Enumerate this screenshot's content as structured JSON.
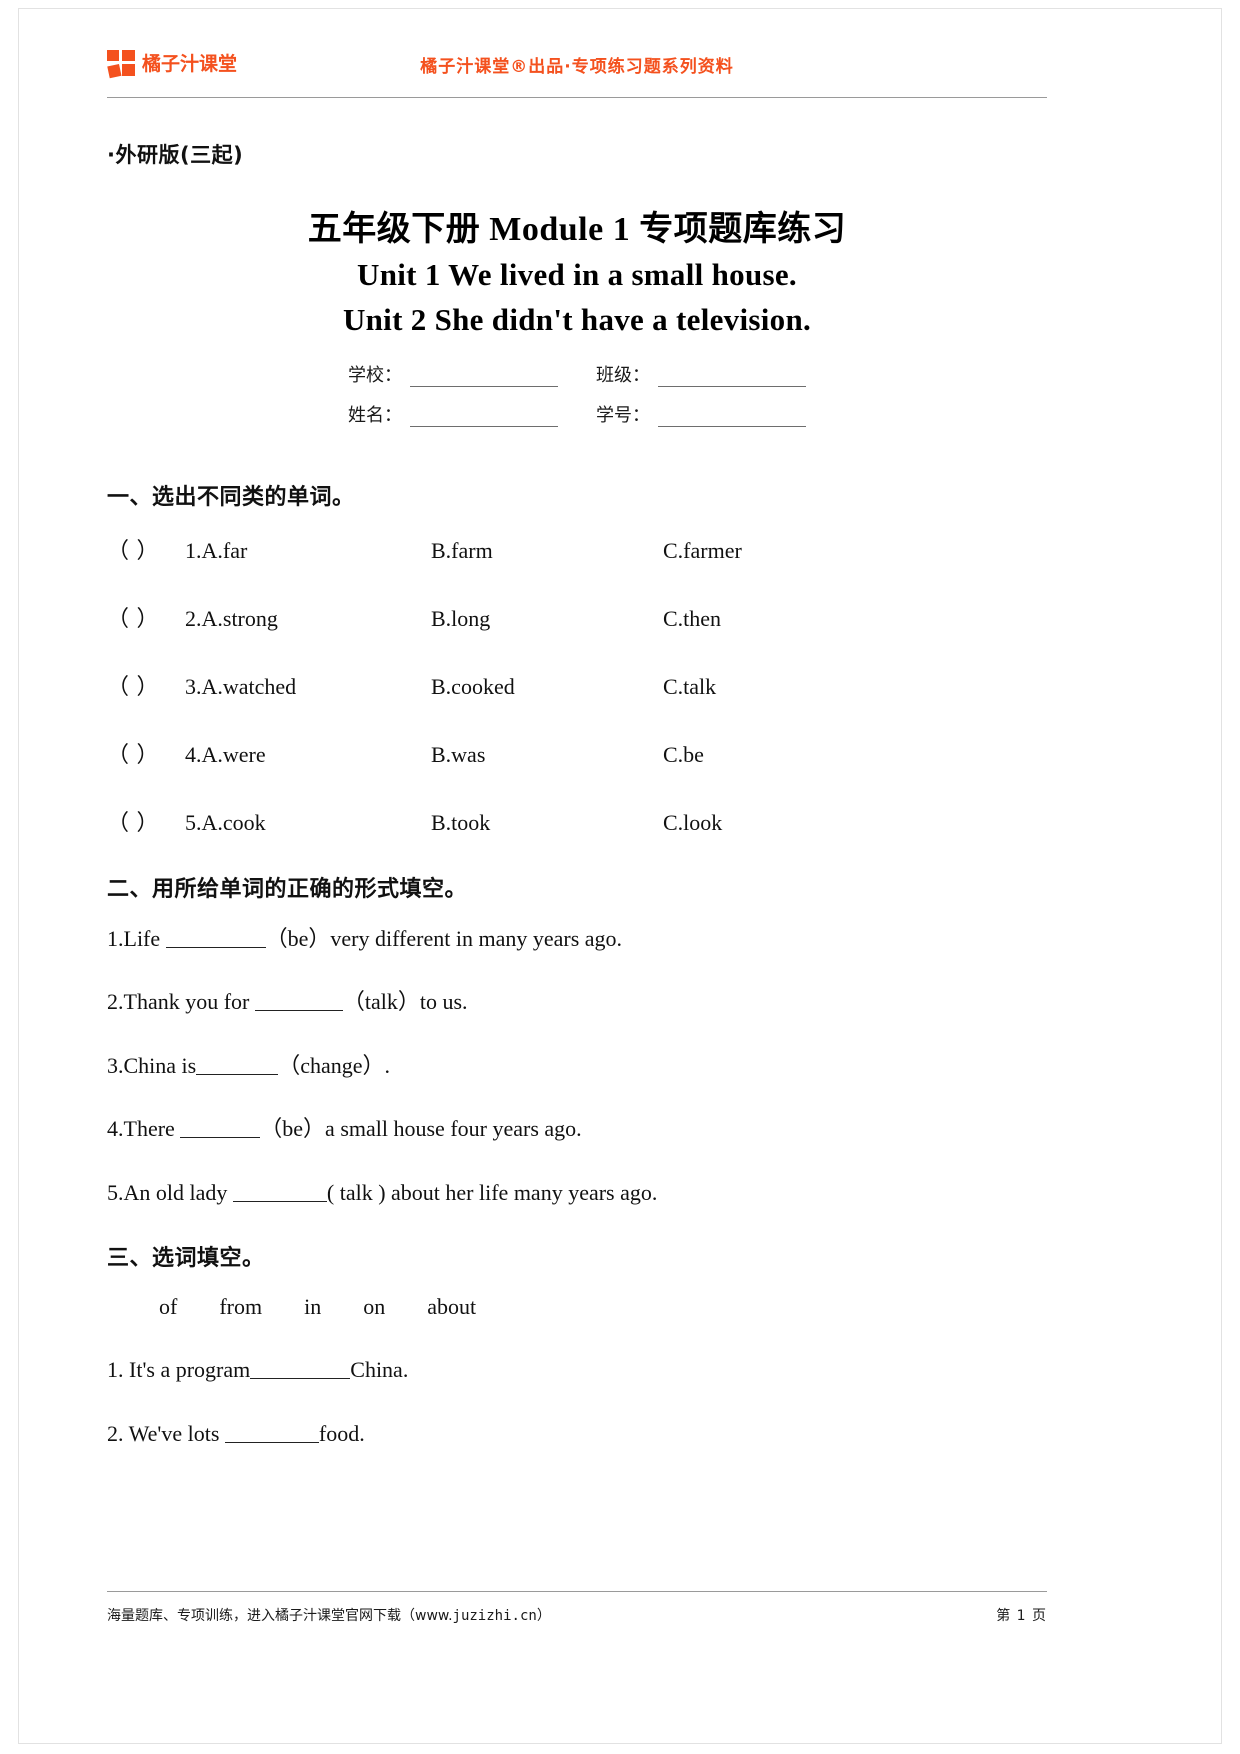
{
  "header": {
    "brand_name": "橘子汁课堂",
    "center_text": "橘子汁课堂®出品·专项练习题系列资料"
  },
  "edition": "·外研版(三起)",
  "title": {
    "line1": "五年级下册 Module 1 专项题库练习",
    "line2": "Unit 1 We lived in a small house.",
    "line3": "Unit 2 She didn't have a television."
  },
  "info_fields": {
    "school": "学校：",
    "class": "班级：",
    "name": "姓名：",
    "student_id": "学号："
  },
  "sections": [
    {
      "heading": "一、选出不同类的单词。",
      "bracket": "（    ）",
      "questions": [
        {
          "num": "1.",
          "a": "A.far",
          "b": "B.farm",
          "c": "C.farmer"
        },
        {
          "num": "2.",
          "a": "A.strong",
          "b": "B.long",
          "c": "C.then"
        },
        {
          "num": "3.",
          "a": "A.watched",
          "b": "B.cooked",
          "c": "C.talk"
        },
        {
          "num": "4.",
          "a": "A.were",
          "b": "B.was",
          "c": "C.be"
        },
        {
          "num": "5.",
          "a": "A.cook",
          "b": "B.took",
          "c": "C.look"
        }
      ]
    },
    {
      "heading": "二、用所给单词的正确的形式填空。",
      "items": [
        {
          "pre": "1.Life ",
          "post": "（be）very different in many years ago."
        },
        {
          "pre": "2.Thank you for ",
          "post": "（talk）to us."
        },
        {
          "pre": "3.China is",
          "post": "（change）."
        },
        {
          "pre": "4.There ",
          "post": "（be）a small house four years ago."
        },
        {
          "pre": "5.An old lady ",
          "post": "( talk ) about her life many years ago."
        }
      ]
    },
    {
      "heading": "三、选词填空。",
      "word_bank": [
        "of",
        "from",
        "in",
        "on",
        "about"
      ],
      "items": [
        {
          "pre": "1. It's a program",
          "post": "China."
        },
        {
          "pre": "2. We've lots ",
          "post": "food."
        }
      ]
    }
  ],
  "footer": {
    "left_text": "海量题库、专项训练，进入橘子汁课堂官网下载（www.",
    "left_url": "juzizhi.cn",
    "left_tail": "）",
    "page": "第 1 页"
  },
  "colors": {
    "brand_orange": "#f4511e",
    "rule_gray": "#9a9a9a",
    "text_black": "#111111"
  }
}
